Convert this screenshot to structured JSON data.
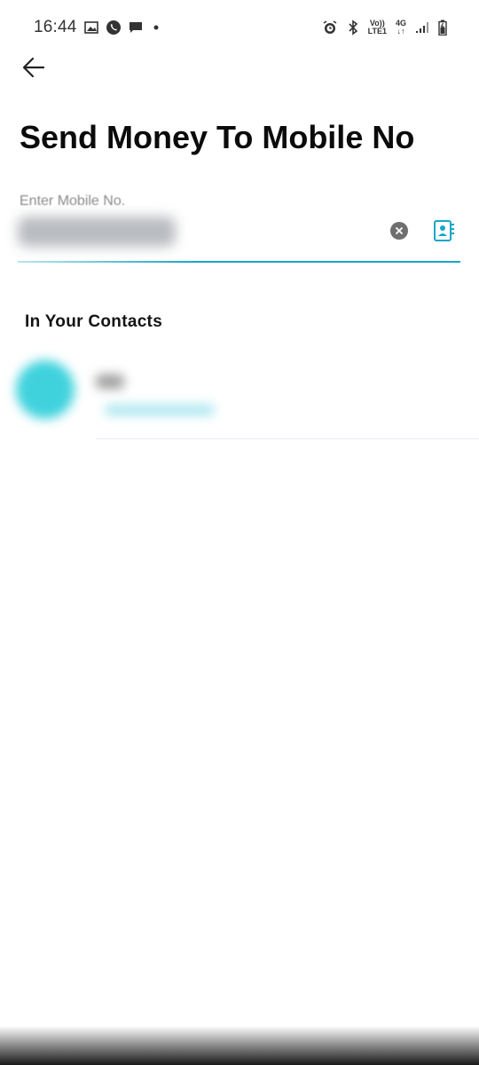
{
  "status_bar": {
    "time": "16:44",
    "left_icons": [
      "gallery-icon",
      "whatsapp-call-icon",
      "message-icon",
      "dot-icon"
    ],
    "right_icons": [
      "alarm-icon",
      "bluetooth-icon",
      "volte-icon",
      "network-4g-icon",
      "signal-icon",
      "battery-icon"
    ],
    "volte_top": "Vo))",
    "volte_bottom": "LTE1",
    "net_top": "4G",
    "net_bottom": "↓↑"
  },
  "header": {
    "back_icon": "back-arrow-icon",
    "title": "Send Money To Mobile No"
  },
  "mobile_input": {
    "label": "Enter Mobile No.",
    "value": "",
    "clear_icon": "clear-icon",
    "contacts_icon": "contacts-book-icon"
  },
  "contacts_section": {
    "heading": "In Your Contacts",
    "items": [
      {
        "name": "",
        "number": "",
        "avatar_color": "#3fd2dd"
      }
    ]
  },
  "colors": {
    "accent": "#16a6c9",
    "avatar": "#3fd2dd",
    "title": "#0b0b0b"
  }
}
